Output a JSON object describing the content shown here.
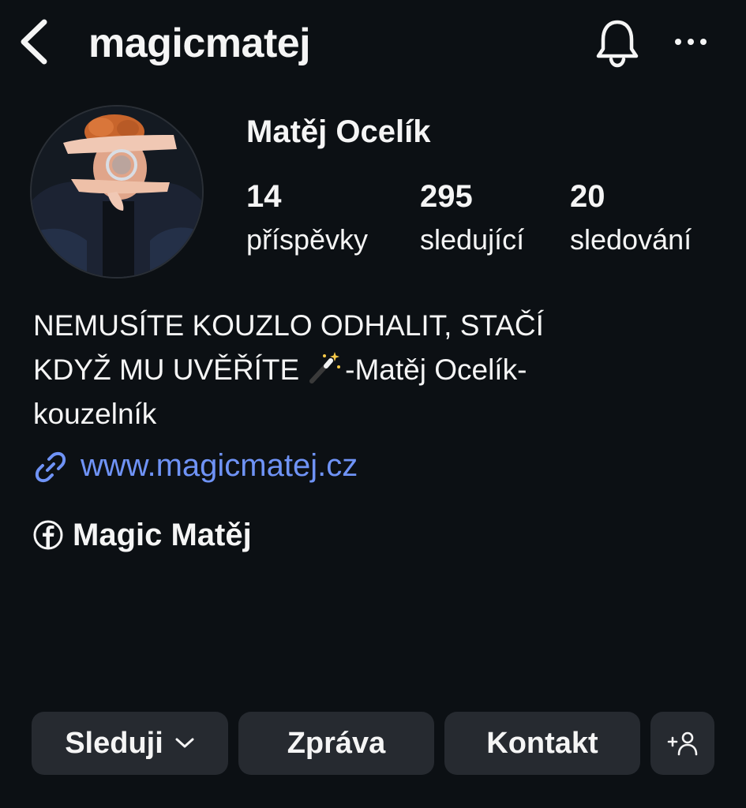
{
  "header": {
    "username": "magicmatej",
    "back_icon": "chevron-left-icon",
    "bell_icon": "bell-icon",
    "more_icon": "more-horizontal-icon"
  },
  "profile": {
    "display_name": "Matěj Ocelík",
    "avatar_icon": "avatar-photo",
    "stats": {
      "posts": {
        "count": "14",
        "label": "příspěvky"
      },
      "followers": {
        "count": "295",
        "label": "sledující"
      },
      "following": {
        "count": "20",
        "label": "sledování"
      }
    },
    "bio": {
      "line1": "NEMUSÍTE KOUZLO ODHALIT, STAČÍ",
      "line2_before": "KDYŽ MU UVĚŘÍTE",
      "line2_after": "-Matěj Ocelík-",
      "line3": "kouzelník",
      "emoji_icon": "magic-wand-icon"
    },
    "link": {
      "text": "www.magicmatej.cz",
      "icon": "link-icon",
      "color": "#6f93f6"
    },
    "facebook": {
      "text": "Magic Matěj",
      "icon": "facebook-icon"
    }
  },
  "actions": {
    "follow_label": "Sleduji",
    "message_label": "Zpráva",
    "contact_label": "Kontakt",
    "add_user_icon": "add-user-icon"
  },
  "colors": {
    "background": "#0c1014",
    "button_bg": "#262a30",
    "text": "#f5f5f5"
  }
}
